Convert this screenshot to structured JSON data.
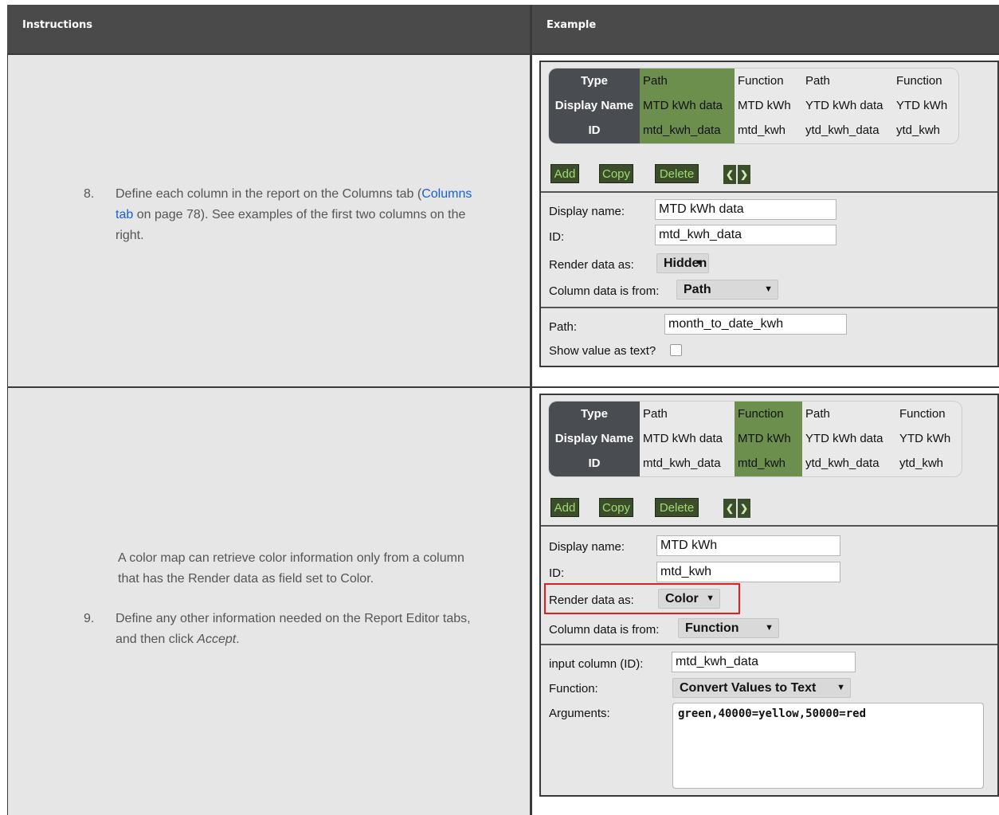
{
  "header": {
    "instructions_label": "Instructions",
    "example_label": "Example"
  },
  "row1": {
    "step_number": "8.",
    "step_text_1": "Define each column in the report on the Columns tab (",
    "step_link_1": "Columns",
    "step_link_2": "tab",
    "step_text_2": " on page 78). See examples of the first two columns on the",
    "step_text_3": "right."
  },
  "row2": {
    "note_line_1": "A color map can retrieve color information only from a column",
    "note_line_2": "that has the Render data as field set to Color.",
    "step_number": "9.",
    "step_line_1": "Define any other information needed on the Report Editor tabs,",
    "step_line_2_a": "and then click ",
    "step_line_2_b": "Accept",
    "step_line_2_c": "."
  },
  "editor1": {
    "row_labels": [
      "Type",
      "Display Name",
      "ID"
    ],
    "columns": [
      {
        "type": "Path",
        "display_name": "MTD kWh data",
        "id": "mtd_kwh_data"
      },
      {
        "type": "Function",
        "display_name": "MTD kWh",
        "id": "mtd_kwh"
      },
      {
        "type": "Path",
        "display_name": "YTD kWh data",
        "id": "ytd_kwh_data"
      },
      {
        "type": "Function",
        "display_name": "YTD kWh",
        "id": "ytd_kwh"
      }
    ],
    "selected_column": 0,
    "buttons": {
      "add": "Add",
      "copy": "Copy",
      "delete": "Delete",
      "prev": "❮",
      "next": "❯"
    },
    "display_name_label": "Display name:",
    "display_name_value": "MTD kWh data",
    "id_label": "ID:",
    "id_value": "mtd_kwh_data",
    "render_label": "Render data as:",
    "render_value": "Hidden",
    "from_label": "Column data is from:",
    "from_value": "Path",
    "path_label": "Path:",
    "path_value": "month_to_date_kwh",
    "show_text_label": "Show value as text?"
  },
  "editor2": {
    "row_labels": [
      "Type",
      "Display Name",
      "ID"
    ],
    "columns": [
      {
        "type": "Path",
        "display_name": "MTD kWh data",
        "id": "mtd_kwh_data"
      },
      {
        "type": "Function",
        "display_name": "MTD kWh",
        "id": "mtd_kwh"
      },
      {
        "type": "Path",
        "display_name": "YTD kWh data",
        "id": "ytd_kwh_data"
      },
      {
        "type": "Function",
        "display_name": "YTD kWh",
        "id": "ytd_kwh"
      }
    ],
    "selected_column": 1,
    "buttons": {
      "add": "Add",
      "copy": "Copy",
      "delete": "Delete",
      "prev": "❮",
      "next": "❯"
    },
    "display_name_label": "Display name:",
    "display_name_value": "MTD kWh",
    "id_label": "ID:",
    "id_value": "mtd_kwh",
    "render_label": "Render data as:",
    "render_value": "Color",
    "from_label": "Column data is from:",
    "from_value": "Function",
    "input_label": "input column (ID):",
    "input_value": "mtd_kwh_data",
    "function_label": "Function:",
    "function_value": "Convert Values to Text",
    "arguments_label": "Arguments:",
    "arguments_value": "green,40000=yellow,50000=red"
  },
  "colors": {
    "header_bg": "#4a4a4a",
    "cell_bg": "#e6e6e6",
    "selected_col": "#6d8f4e",
    "button_bg": "#3c4d2b",
    "button_text": "#9fdc6f",
    "link": "#1a5fd6",
    "highlight": "#e01f25"
  }
}
